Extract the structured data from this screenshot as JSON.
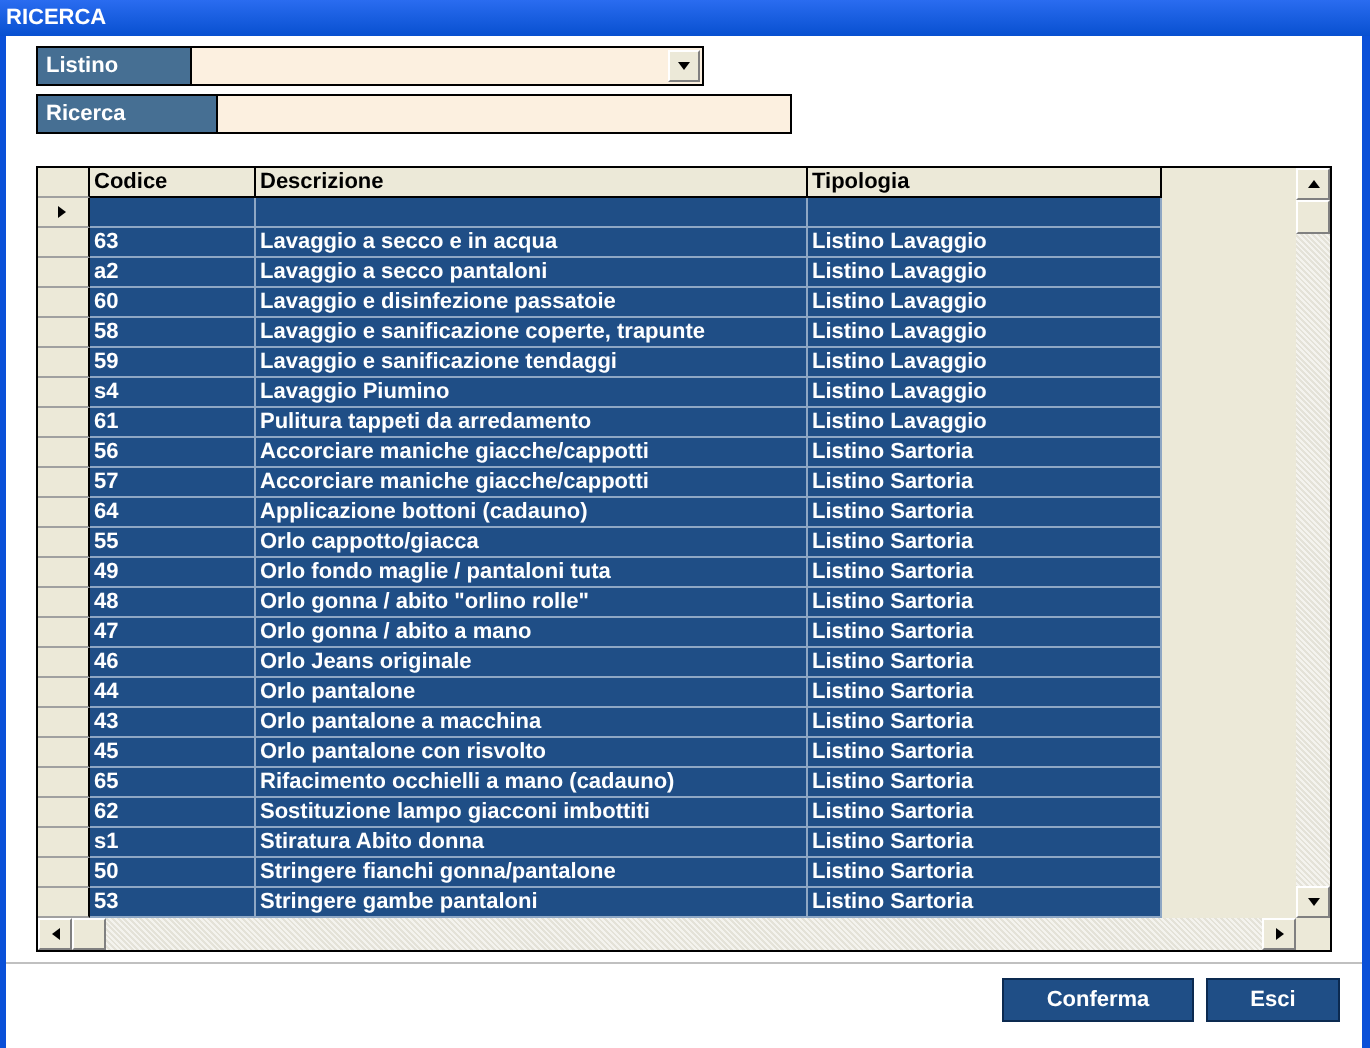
{
  "window": {
    "title": "RICERCA"
  },
  "filters": [
    {
      "kind": "dropdown",
      "label": "Listino"
    },
    {
      "kind": "text",
      "label": "Ricerca"
    }
  ],
  "table": {
    "columns": [
      "Codice",
      "Descrizione",
      "Tipologia"
    ],
    "new_row": {
      "current": true,
      "selected": true
    },
    "rows": [
      {
        "cells": [
          "63",
          "Lavaggio a secco e in acqua",
          "Listino Lavaggio"
        ],
        "selected": true
      },
      {
        "cells": [
          "a2",
          "Lavaggio a secco pantaloni",
          "Listino Lavaggio"
        ],
        "selected": true
      },
      {
        "cells": [
          "60",
          "Lavaggio e disinfezione passatoie",
          "Listino Lavaggio"
        ],
        "selected": true
      },
      {
        "cells": [
          "58",
          "Lavaggio e sanificazione coperte, trapunte",
          "Listino Lavaggio"
        ],
        "selected": true
      },
      {
        "cells": [
          "59",
          "Lavaggio e sanificazione tendaggi",
          "Listino Lavaggio"
        ],
        "selected": true
      },
      {
        "cells": [
          "s4",
          "Lavaggio Piumino",
          "Listino Lavaggio"
        ],
        "selected": true
      },
      {
        "cells": [
          "61",
          "Pulitura tappeti da arredamento",
          "Listino Lavaggio"
        ],
        "selected": true
      },
      {
        "cells": [
          "56",
          "Accorciare maniche giacche/cappotti",
          "Listino Sartoria"
        ],
        "selected": true
      },
      {
        "cells": [
          "57",
          "Accorciare maniche giacche/cappotti",
          "Listino Sartoria"
        ],
        "selected": true
      },
      {
        "cells": [
          "64",
          "Applicazione bottoni (cadauno)",
          "Listino Sartoria"
        ],
        "selected": true
      },
      {
        "cells": [
          "55",
          "Orlo cappotto/giacca",
          "Listino Sartoria"
        ],
        "selected": true
      },
      {
        "cells": [
          "49",
          "Orlo fondo maglie / pantaloni tuta",
          "Listino Sartoria"
        ],
        "selected": true
      },
      {
        "cells": [
          "48",
          "Orlo gonna / abito \"orlino rolle\"",
          "Listino Sartoria"
        ],
        "selected": true
      },
      {
        "cells": [
          "47",
          "Orlo gonna / abito a mano",
          "Listino Sartoria"
        ],
        "selected": true
      },
      {
        "cells": [
          "46",
          "Orlo Jeans originale",
          "Listino Sartoria"
        ],
        "selected": true
      },
      {
        "cells": [
          "44",
          "Orlo pantalone",
          "Listino Sartoria"
        ],
        "selected": true
      },
      {
        "cells": [
          "43",
          "Orlo pantalone a macchina",
          "Listino Sartoria"
        ],
        "selected": true
      },
      {
        "cells": [
          "45",
          "Orlo pantalone con risvolto",
          "Listino Sartoria"
        ],
        "selected": true
      },
      {
        "cells": [
          "65",
          "Rifacimento occhielli a mano (cadauno)",
          "Listino Sartoria"
        ],
        "selected": true
      },
      {
        "cells": [
          "62",
          "Sostituzione lampo giacconi imbottiti",
          "Listino Sartoria"
        ],
        "selected": true
      },
      {
        "cells": [
          "s1",
          "Stiratura Abito donna",
          "Listino Sartoria"
        ],
        "selected": true
      },
      {
        "cells": [
          "50",
          "Stringere fianchi gonna/pantalone",
          "Listino Sartoria"
        ],
        "selected": true
      },
      {
        "cells": [
          "53",
          "Stringere gambe pantaloni",
          "Listino Sartoria"
        ],
        "selected": true
      }
    ]
  },
  "buttons": [
    "Conferma",
    "Esci"
  ]
}
